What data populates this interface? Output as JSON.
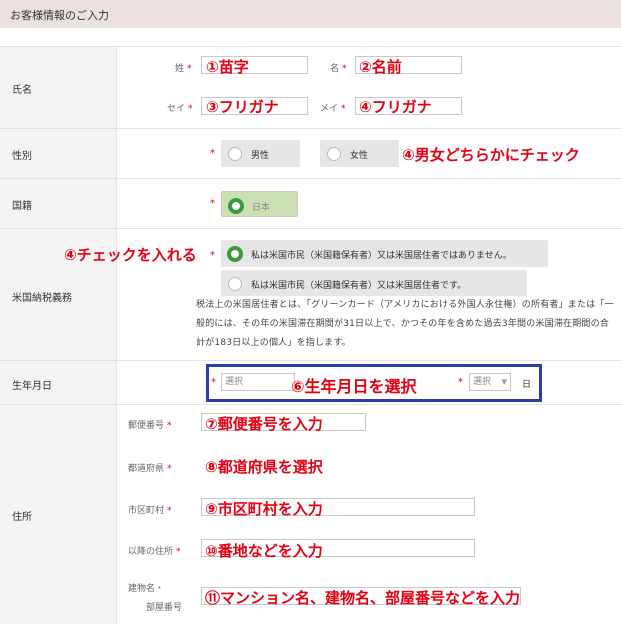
{
  "header": {
    "title": "お客様情報のご入力"
  },
  "sections": {
    "name": "氏名",
    "gender": "性別",
    "nationality": "国籍",
    "us_tax": "米国納税義務",
    "birthdate": "生年月日",
    "address": "住所"
  },
  "name": {
    "last_label": "姓",
    "first_label": "名",
    "last_kana_label": "セイ",
    "first_kana_label": "メイ",
    "ann_last": "①苗字",
    "ann_first": "②名前",
    "ann_last_kana": "③フリガナ",
    "ann_first_kana": "④フリガナ"
  },
  "required_mark": "*",
  "gender": {
    "male": "男性",
    "female": "女性",
    "ann": "④男女どちらかにチェック"
  },
  "nationality": {
    "japan": "日本"
  },
  "us_tax": {
    "ann": "④チェックを入れる",
    "option_not": "私は米国市民（米国籍保有者）又は米国居住者ではありません。",
    "option_is": "私は米国市民（米国籍保有者）又は米国居住者です。",
    "note": "税法上の米国居住者とは、「グリーンカード（アメリカにおける外国人永住権）の所有者」または「一般的には、その年の米国滞在期間が31日以上で、かつその年を含めた過去3年間の米国滞在期間の合計が183日以上の個人」を指します。"
  },
  "birthdate": {
    "select_placeholder": "選択",
    "select_placeholder2": "選択",
    "day_suffix": "日",
    "ann": "⑥生年月日を選択"
  },
  "address": {
    "postal_label": "郵便番号",
    "prefecture_label": "都道府県",
    "city_label": "市区町村",
    "street_label": "以降の住所",
    "building_label_1": "建物名・",
    "building_label_2": "部屋番号",
    "ann_postal": "⑦郵便番号を入力",
    "ann_prefecture": "⑧都道府県を選択",
    "ann_city": "⑨市区町村を入力",
    "ann_street": "⑩番地などを入力",
    "ann_building": "⑪マンション名、建物名、部屋番号などを入力"
  },
  "colors": {
    "annotation": "#e60012",
    "highlight_box": "#2b3da6",
    "selected_radio": "#cde0b3"
  }
}
